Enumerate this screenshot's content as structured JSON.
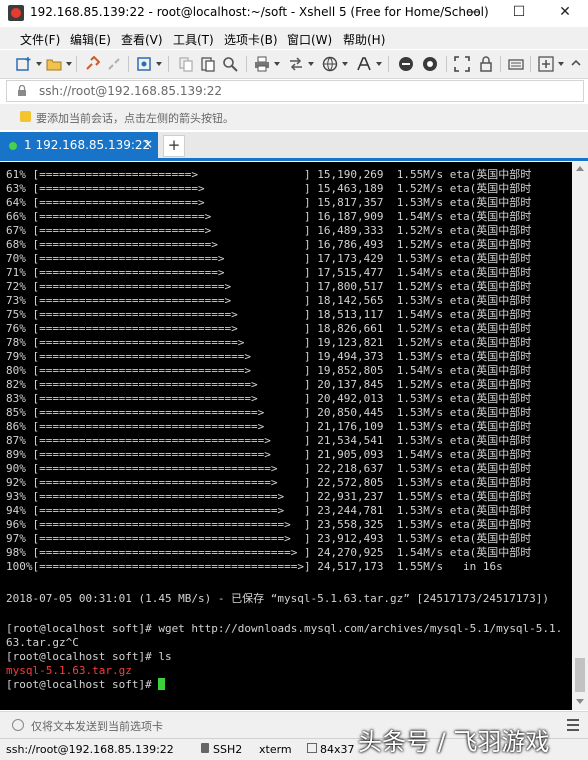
{
  "window": {
    "title": "192.168.85.139:22 - root@localhost:~/soft - Xshell 5 (Free for Home/School)",
    "minimize": "—",
    "maximize": "☐",
    "close": "✕"
  },
  "menu": [
    "文件(F)",
    "编辑(E)",
    "查看(V)",
    "工具(T)",
    "选项卡(B)",
    "窗口(W)",
    "帮助(H)"
  ],
  "toolbar": {
    "icons": [
      "new-session-icon",
      "open-folder-icon",
      "link-icon",
      "unlink-icon",
      "properties-icon",
      "copy-icon",
      "paste-icon",
      "find-icon",
      "print-icon",
      "transfer-icon",
      "globe-icon",
      "font-icon",
      "xftp-icon",
      "xmanager-icon",
      "fullscreen-icon",
      "lock-icon",
      "keyboard-icon",
      "add-icon",
      "help-icon"
    ]
  },
  "address": {
    "text": "ssh://root@192.168.85.139:22"
  },
  "hint": {
    "text": "要添加当前会话，点击左侧的箭头按钮。"
  },
  "tabs": [
    {
      "label": "1 192.168.85.139:22",
      "close": "×",
      "active": true
    }
  ],
  "tab_add": "+",
  "terminal": {
    "progress_lines": [
      "61% [=======================>                ] 15,190,269  1.55M/s eta(英国中部时",
      "63% [========================>               ] 15,463,189  1.52M/s eta(英国中部时",
      "64% [========================>               ] 15,817,357  1.53M/s eta(英国中部时",
      "66% [=========================>              ] 16,187,909  1.54M/s eta(英国中部时",
      "67% [=========================>              ] 16,489,333  1.52M/s eta(英国中部时",
      "68% [==========================>             ] 16,786,493  1.52M/s eta(英国中部时",
      "70% [===========================>            ] 17,173,429  1.53M/s eta(英国中部时",
      "71% [===========================>            ] 17,515,477  1.54M/s eta(英国中部时",
      "72% [============================>           ] 17,800,517  1.52M/s eta(英国中部时",
      "73% [============================>           ] 18,142,565  1.53M/s eta(英国中部时",
      "75% [=============================>          ] 18,513,117  1.54M/s eta(英国中部时",
      "76% [=============================>          ] 18,826,661  1.52M/s eta(英国中部时",
      "78% [==============================>         ] 19,123,821  1.52M/s eta(英国中部时",
      "79% [===============================>        ] 19,494,373  1.53M/s eta(英国中部时",
      "80% [===============================>        ] 19,852,805  1.54M/s eta(英国中部时",
      "82% [================================>       ] 20,137,845  1.52M/s eta(英国中部时",
      "83% [================================>       ] 20,492,013  1.53M/s eta(英国中部时",
      "85% [=================================>      ] 20,850,445  1.53M/s eta(英国中部时",
      "86% [=================================>      ] 21,176,109  1.53M/s eta(英国中部时",
      "87% [==================================>     ] 21,534,541  1.53M/s eta(英国中部时",
      "89% [==================================>     ] 21,905,093  1.54M/s eta(英国中部时",
      "90% [===================================>    ] 22,218,637  1.53M/s eta(英国中部时",
      "92% [===================================>    ] 22,572,805  1.53M/s eta(英国中部时",
      "93% [====================================>   ] 22,931,237  1.55M/s eta(英国中部时",
      "94% [====================================>   ] 23,244,781  1.53M/s eta(英国中部时",
      "96% [=====================================>  ] 23,558,325  1.53M/s eta(英国中部时",
      "97% [=====================================>  ] 23,912,493  1.53M/s eta(英国中部时",
      "98% [======================================> ] 24,270,925  1.54M/s eta(英国中部时",
      "100%[=======================================>] 24,517,173  1.55M/s   in 16s"
    ],
    "saved_line": "2018-07-05 00:31:01 (1.45 MB/s) - 已保存 “mysql-5.1.63.tar.gz” [24517173/24517173])",
    "wget_line1": "[root@localhost soft]# wget http://downloads.mysql.com/archives/mysql-5.1/mysql-5.1.",
    "wget_line2": "63.tar.gz^C",
    "ls_line": "[root@localhost soft]# ls",
    "ls_output": "mysql-5.1.63.tar.gz",
    "prompt": "[root@localhost soft]# ",
    "colors": {
      "background": "#000000",
      "text": "#d3d3d3",
      "file": "#ff3b3b",
      "cursor": "#3ad13a"
    }
  },
  "send_bar": {
    "text": "仅将文本发送到当前选项卡"
  },
  "status": {
    "connection": "ssh://root@192.168.85.139:22",
    "protocol": "SSH2",
    "term": "xterm",
    "size": "84x37"
  },
  "watermark": "头条号 / 飞羽游戏",
  "colors": {
    "tab_active": "#1874c8",
    "chrome": "#f0f0f0"
  }
}
